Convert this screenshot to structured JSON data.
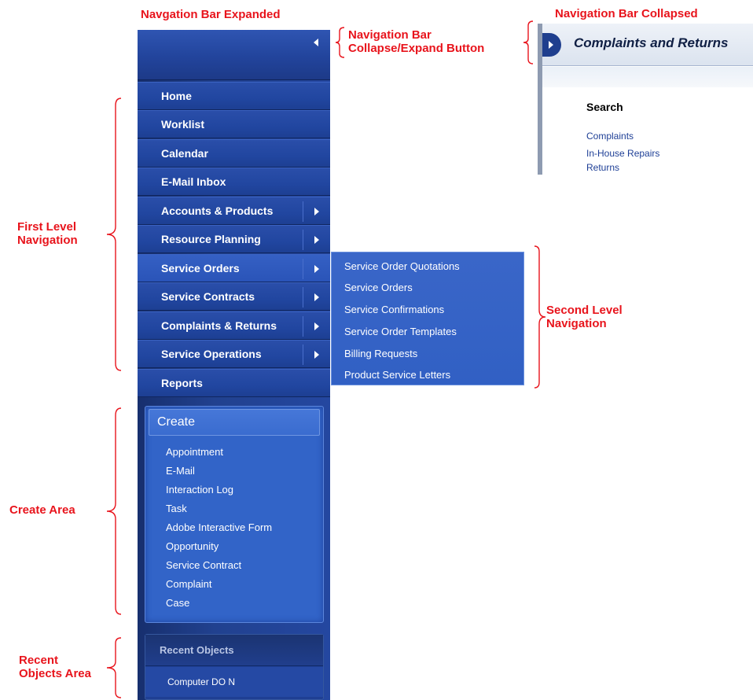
{
  "callouts": {
    "expanded": "Navgation Bar Expanded",
    "collapsed": "Navigation Bar Collapsed",
    "collapse_button": "Navigation Bar\nCollapse/Expand Button",
    "first_level": "First Level\nNavigation",
    "second_level": "Second Level\nNavigation",
    "create_area": "Create Area",
    "recent_area": "Recent\nObjects Area"
  },
  "nav": {
    "items": [
      {
        "label": "Home",
        "has_submenu": false
      },
      {
        "label": "Worklist",
        "has_submenu": false
      },
      {
        "label": "Calendar",
        "has_submenu": false
      },
      {
        "label": "E-Mail Inbox",
        "has_submenu": false
      },
      {
        "label": "Accounts & Products",
        "has_submenu": true
      },
      {
        "label": "Resource Planning",
        "has_submenu": true
      },
      {
        "label": "Service Orders",
        "has_submenu": true
      },
      {
        "label": "Service Contracts",
        "has_submenu": true
      },
      {
        "label": "Complaints & Returns",
        "has_submenu": true
      },
      {
        "label": "Service Operations",
        "has_submenu": true
      },
      {
        "label": "Reports",
        "has_submenu": false
      }
    ],
    "second_level": [
      "Service Order Quotations",
      "Service Orders",
      "Service Confirmations",
      "Service Order Templates",
      "Billing Requests",
      "Product Service Letters"
    ]
  },
  "create": {
    "header": "Create",
    "items": [
      "Appointment",
      "E-Mail",
      "Interaction Log",
      "Task",
      "Adobe Interactive Form",
      "Opportunity",
      "Service Contract",
      "Complaint",
      "Case"
    ]
  },
  "recent": {
    "header": "Recent Objects",
    "items": [
      "Computer DO N"
    ]
  },
  "collapsed_view": {
    "title": "Complaints and Returns",
    "search_label": "Search",
    "links": [
      "Complaints",
      "In-House Repairs",
      "Returns"
    ]
  },
  "colors": {
    "annotation": "#e8141c",
    "nav_dark": "#172f6e",
    "nav_item": "#2146a0",
    "create_bg": "#3264c8",
    "link": "#1e3f96"
  }
}
